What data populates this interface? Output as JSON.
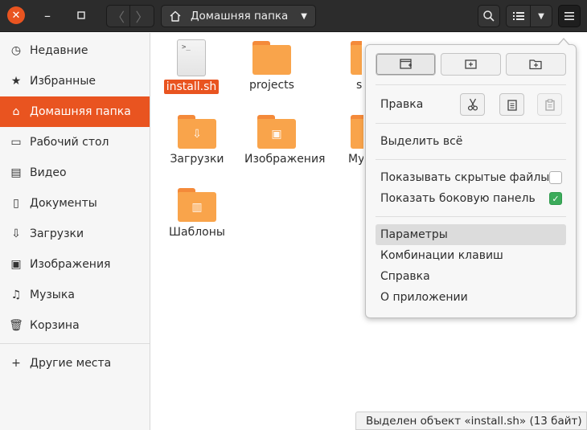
{
  "header": {
    "close_glyph": "✕",
    "min_glyph": "–",
    "max_glyph": "□",
    "back_glyph": "〈",
    "forward_glyph": "〉",
    "location": "Домашняя папка",
    "caret_glyph": "▼",
    "hamburger_glyph": "≡"
  },
  "sidebar": {
    "items": [
      {
        "label": "Недавние",
        "icon": "clock-icon",
        "glyph": "◷"
      },
      {
        "label": "Избранные",
        "icon": "star-icon",
        "glyph": "★"
      },
      {
        "label": "Домашняя папка",
        "icon": "home-icon",
        "glyph": "⌂"
      },
      {
        "label": "Рабочий стол",
        "icon": "desktop-icon",
        "glyph": "▭"
      },
      {
        "label": "Видео",
        "icon": "film-icon",
        "glyph": "▤"
      },
      {
        "label": "Документы",
        "icon": "document-icon",
        "glyph": "▯"
      },
      {
        "label": "Загрузки",
        "icon": "download-icon",
        "glyph": "⇩"
      },
      {
        "label": "Изображения",
        "icon": "image-icon",
        "glyph": "▣"
      },
      {
        "label": "Музыка",
        "icon": "music-icon",
        "glyph": "♫"
      },
      {
        "label": "Корзина",
        "icon": "trash-icon",
        "glyph": "🗑"
      }
    ],
    "other": {
      "label": "Другие места",
      "glyph": "+"
    }
  },
  "files": [
    {
      "name": "install.sh",
      "type": "script",
      "selected": true,
      "emblem": ""
    },
    {
      "name": "projects",
      "type": "folder",
      "emblem": ""
    },
    {
      "name": "sn",
      "type": "folder",
      "emblem": ""
    },
    {
      "name": "Загрузки",
      "type": "folder",
      "emblem": "⇩"
    },
    {
      "name": "Изображения",
      "type": "folder",
      "emblem": "▣"
    },
    {
      "name": "Му",
      "type": "folder",
      "emblem": ""
    },
    {
      "name": "Шаблоны",
      "type": "folder",
      "emblem": "▥"
    }
  ],
  "script_glyph": ">_",
  "menu": {
    "edit_label": "Правка",
    "select_all": "Выделить всё",
    "show_hidden": "Показывать скрытые файлы",
    "show_hidden_checked": false,
    "show_sidebar": "Показать боковую панель",
    "show_sidebar_checked": true,
    "items": [
      "Параметры",
      "Комбинации клавиш",
      "Справка",
      "О приложении"
    ],
    "highlighted": "Параметры",
    "check_glyph": "✓"
  },
  "status": "Выделен объект «install.sh» (13 байт)",
  "colors": {
    "accent": "#e95420",
    "folder": "#f9a44b",
    "check": "#3cab5b"
  }
}
